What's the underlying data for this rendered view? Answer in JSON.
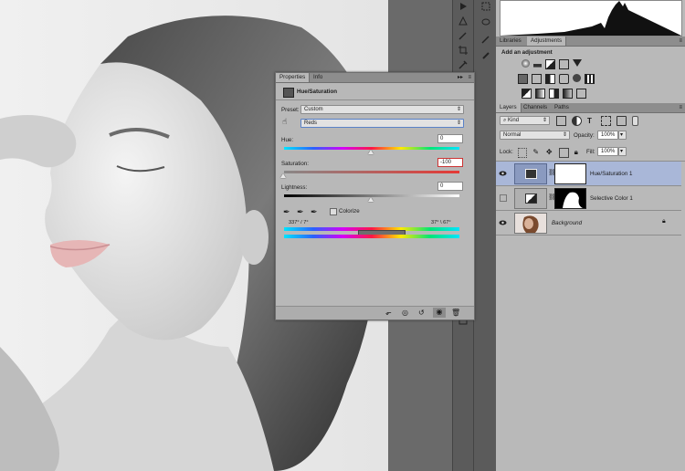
{
  "properties_panel": {
    "tabs": [
      "Properties",
      "Info"
    ],
    "title": "Hue/Saturation",
    "preset_label": "Preset:",
    "preset_value": "Custom",
    "channel_value": "Reds",
    "hue_label": "Hue:",
    "hue_value": "0",
    "saturation_label": "Saturation:",
    "saturation_value": "-100",
    "lightness_label": "Lightness:",
    "lightness_value": "0",
    "colorize_label": "Colorize",
    "range_left": "337° / 7°",
    "range_right": "37° \\ 67°"
  },
  "adjustments_panel": {
    "tabs": [
      "Libraries",
      "Adjustments"
    ],
    "heading": "Add an adjustment"
  },
  "layers_panel": {
    "tabs": [
      "Layers",
      "Channels",
      "Paths"
    ],
    "filter_kind": "Kind",
    "blend_mode": "Normal",
    "opacity_label": "Opacity:",
    "opacity_value": "100%",
    "lock_label": "Lock:",
    "fill_label": "Fill:",
    "fill_value": "100%",
    "layers": [
      {
        "name": "Hue/Saturation 1",
        "selected": true
      },
      {
        "name": "Selective Color 1",
        "selected": false
      },
      {
        "name": "Background",
        "selected": false
      }
    ]
  },
  "colors": {
    "selected_layer": "#a9b7d8",
    "panel_bg": "#b9b9b9",
    "workspace": "#535353"
  }
}
